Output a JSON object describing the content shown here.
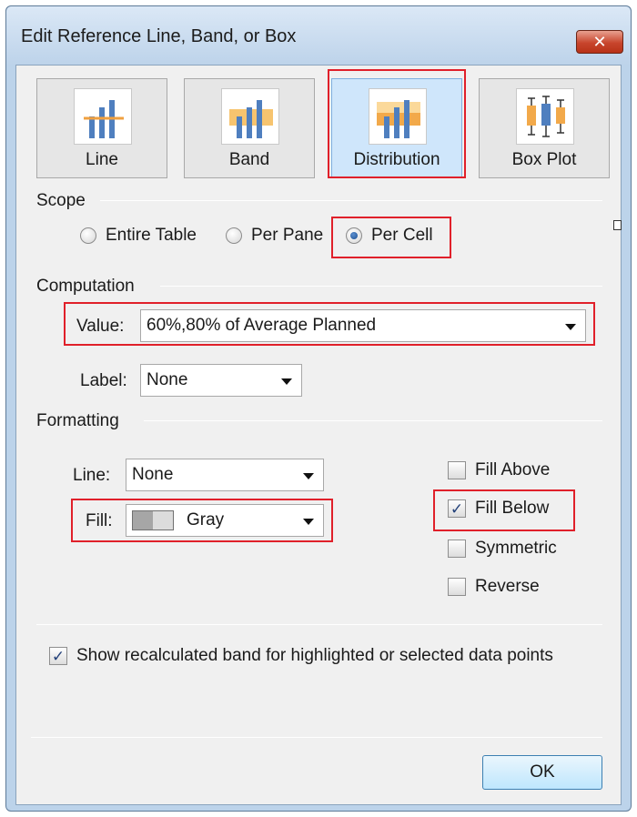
{
  "window": {
    "title": "Edit Reference Line, Band, or Box",
    "close_label": "✕"
  },
  "tiles": [
    {
      "label": "Line"
    },
    {
      "label": "Band"
    },
    {
      "label": "Distribution"
    },
    {
      "label": "Box Plot"
    }
  ],
  "scope": {
    "label": "Scope",
    "options": [
      "Entire Table",
      "Per Pane",
      "Per Cell"
    ],
    "selected": "Per Cell"
  },
  "computation": {
    "label": "Computation",
    "value_label": "Value:",
    "value": "60%,80% of Average Planned",
    "label_label": "Label:",
    "label_value": "None"
  },
  "formatting": {
    "label": "Formatting",
    "line_label": "Line:",
    "line_value": "None",
    "fill_label": "Fill:",
    "fill_value": "Gray",
    "checkboxes": {
      "fill_above": {
        "label": "Fill Above",
        "checked": false
      },
      "fill_below": {
        "label": "Fill Below",
        "checked": true
      },
      "symmetric": {
        "label": "Symmetric",
        "checked": false
      },
      "reverse": {
        "label": "Reverse",
        "checked": false
      }
    }
  },
  "show_recalculated": {
    "label": "Show recalculated band for highlighted or selected data points",
    "checked": true
  },
  "buttons": {
    "ok": "OK"
  },
  "colors": {
    "highlight_border": "#e0202a",
    "selected_tile": "#cfe6fb",
    "bar_blue": "#4f7fbf",
    "band_orange": "#f7c46f"
  }
}
